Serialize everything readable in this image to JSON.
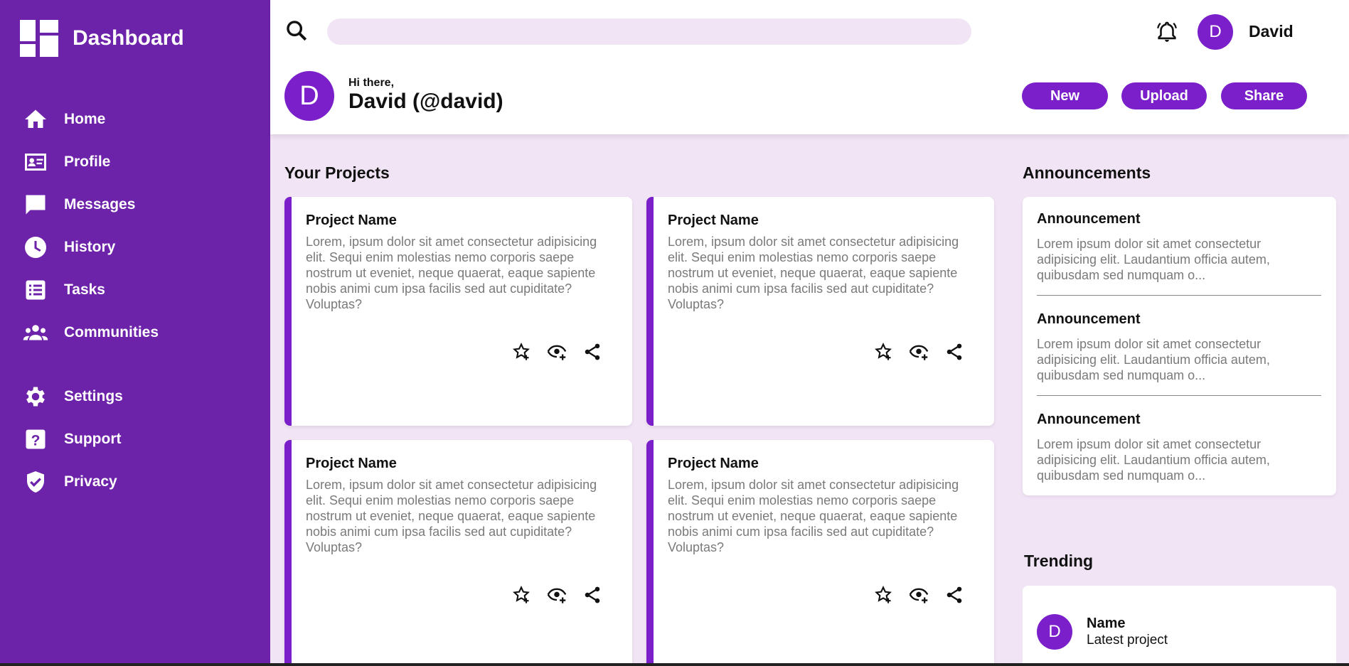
{
  "brand": {
    "title": "Dashboard"
  },
  "sidebar": {
    "items": [
      {
        "label": "Home",
        "icon": "home-icon"
      },
      {
        "label": "Profile",
        "icon": "id-card-icon"
      },
      {
        "label": "Messages",
        "icon": "chat-icon"
      },
      {
        "label": "History",
        "icon": "clock-icon"
      },
      {
        "label": "Tasks",
        "icon": "list-icon"
      },
      {
        "label": "Communities",
        "icon": "people-icon"
      },
      {
        "label": "Settings",
        "icon": "gear-icon"
      },
      {
        "label": "Support",
        "icon": "help-icon"
      },
      {
        "label": "Privacy",
        "icon": "shield-check-icon"
      }
    ]
  },
  "header": {
    "search_placeholder": "",
    "user_initial": "D",
    "user_name": "David",
    "greeting_small": "Hi there,",
    "greeting_name": "David (@david)",
    "buttons": {
      "new": "New",
      "upload": "Upload",
      "share": "Share"
    }
  },
  "projects": {
    "title": "Your Projects",
    "cards": [
      {
        "name": "Project Name",
        "description": "Lorem, ipsum dolor sit amet consectetur adipisicing elit. Sequi enim molestias nemo corporis saepe nostrum ut eveniet, neque quaerat, eaque sapiente nobis animi cum ipsa facilis sed aut cupiditate? Voluptas?"
      },
      {
        "name": "Project Name",
        "description": "Lorem, ipsum dolor sit amet consectetur adipisicing elit. Sequi enim molestias nemo corporis saepe nostrum ut eveniet, neque quaerat, eaque sapiente nobis animi cum ipsa facilis sed aut cupiditate? Voluptas?"
      },
      {
        "name": "Project Name",
        "description": "Lorem, ipsum dolor sit amet consectetur adipisicing elit. Sequi enim molestias nemo corporis saepe nostrum ut eveniet, neque quaerat, eaque sapiente nobis animi cum ipsa facilis sed aut cupiditate? Voluptas?"
      },
      {
        "name": "Project Name",
        "description": "Lorem, ipsum dolor sit amet consectetur adipisicing elit. Sequi enim molestias nemo corporis saepe nostrum ut eveniet, neque quaerat, eaque sapiente nobis animi cum ipsa facilis sed aut cupiditate? Voluptas?"
      }
    ]
  },
  "announcements": {
    "title": "Announcements",
    "items": [
      {
        "title": "Announcement",
        "text": "Lorem ipsum dolor sit amet consectetur adipisicing elit. Laudantium officia autem, quibusdam sed numquam o..."
      },
      {
        "title": "Announcement",
        "text": "Lorem ipsum dolor sit amet consectetur adipisicing elit. Laudantium officia autem, quibusdam sed numquam o..."
      },
      {
        "title": "Announcement",
        "text": "Lorem ipsum dolor sit amet consectetur adipisicing elit. Laudantium officia autem, quibusdam sed numquam o..."
      }
    ]
  },
  "trending": {
    "title": "Trending",
    "items": [
      {
        "initial": "D",
        "name": "Name",
        "subtitle": "Latest project"
      }
    ]
  },
  "colors": {
    "sidebar": "#6d22aa",
    "accent": "#7a1fc9",
    "background": "#f1e4f5"
  }
}
